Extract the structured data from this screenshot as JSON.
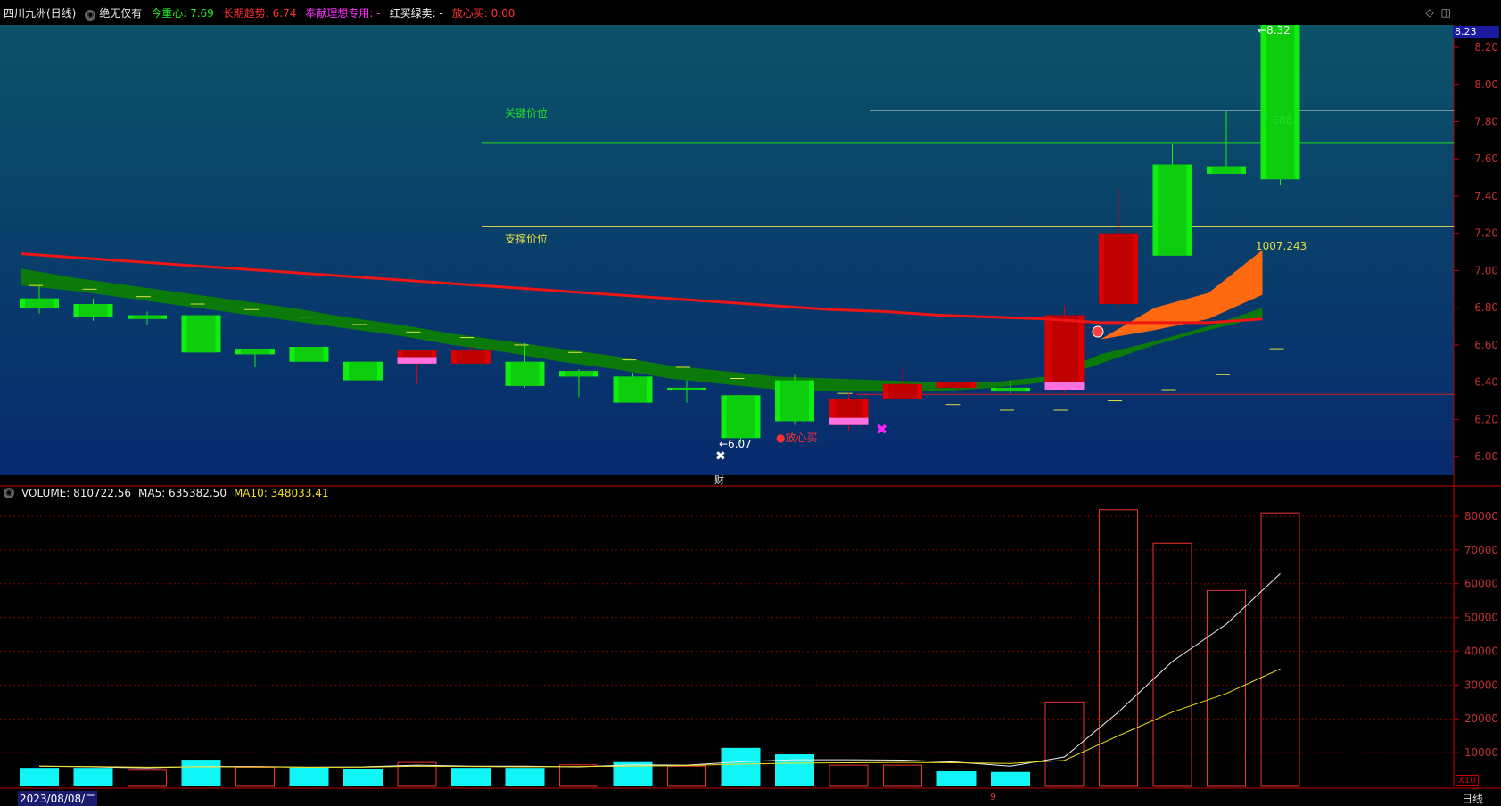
{
  "topbar": {
    "stock": "四川九洲(日线)",
    "indicator": "绝无仅有",
    "items": [
      {
        "label": "今重心: 7.69",
        "color": "#22ee22"
      },
      {
        "label": "长期趋势: 6.74",
        "color": "#ff3030"
      },
      {
        "label": "奉献理想专用: -",
        "color": "#ff30ff"
      },
      {
        "label": "红买绿卖: -",
        "color": "#ffffff"
      },
      {
        "label": "放心买: 0.00",
        "color": "#ff3030"
      }
    ],
    "right_icons": [
      "◇",
      "◫"
    ]
  },
  "volume_header": {
    "vol": "VOLUME: 810722.56",
    "ma5": "MA5: 635382.50",
    "ma10": "MA10: 348033.41"
  },
  "labels": {
    "key_price": "关键价位",
    "support_price": "支撑价位",
    "low_marker": "←6.07",
    "high_marker": "←8.32",
    "line_val": "7.688",
    "fan_val": "1007.243",
    "buy_signal": "●放心买",
    "cai": "财",
    "date": "2023/08/08/二",
    "month_tick": "9",
    "period": "日线",
    "current_price": "8.23",
    "vol_scale": "X10"
  },
  "chart_data": {
    "type": "candlestick",
    "price_ticks": [
      "8.20",
      "8.00",
      "7.80",
      "7.60",
      "7.40",
      "7.20",
      "7.00",
      "6.80",
      "6.60",
      "6.40",
      "6.20",
      "6.00"
    ],
    "volume_ticks": [
      "80000",
      "70000",
      "60000",
      "50000",
      "40000",
      "30000",
      "20000",
      "10000"
    ],
    "ylim_price": [
      5.9,
      8.32
    ],
    "ylim_volume": [
      0,
      85000
    ],
    "key_price_line": 7.688,
    "support_price_line": 7.235,
    "candles": [
      {
        "o": 6.85,
        "c": 6.8,
        "h": 6.92,
        "l": 6.77,
        "up": false
      },
      {
        "o": 6.82,
        "c": 6.75,
        "h": 6.85,
        "l": 6.73,
        "up": false
      },
      {
        "o": 6.76,
        "c": 6.74,
        "h": 6.78,
        "l": 6.71,
        "up": false
      },
      {
        "o": 6.76,
        "c": 6.56,
        "h": 6.76,
        "l": 6.56,
        "up": false
      },
      {
        "o": 6.58,
        "c": 6.55,
        "h": 6.58,
        "l": 6.48,
        "up": false
      },
      {
        "o": 6.59,
        "c": 6.51,
        "h": 6.61,
        "l": 6.46,
        "up": false
      },
      {
        "o": 6.51,
        "c": 6.41,
        "h": 6.51,
        "l": 6.41,
        "up": false
      },
      {
        "o": 6.5,
        "c": 6.57,
        "h": 6.57,
        "l": 6.39,
        "up": true,
        "pink": true
      },
      {
        "o": 6.5,
        "c": 6.57,
        "h": 6.59,
        "l": 6.5,
        "up": true
      },
      {
        "o": 6.51,
        "c": 6.38,
        "h": 6.61,
        "l": 6.37,
        "up": false
      },
      {
        "o": 6.46,
        "c": 6.43,
        "h": 6.47,
        "l": 6.32,
        "up": false
      },
      {
        "o": 6.43,
        "c": 6.29,
        "h": 6.45,
        "l": 6.29,
        "up": false
      },
      {
        "o": 6.37,
        "c": 6.36,
        "h": 6.41,
        "l": 6.29,
        "up": false
      },
      {
        "o": 6.33,
        "c": 6.1,
        "h": 6.33,
        "l": 6.07,
        "up": false
      },
      {
        "o": 6.41,
        "c": 6.19,
        "h": 6.44,
        "l": 6.17,
        "up": false
      },
      {
        "o": 6.17,
        "c": 6.31,
        "h": 6.34,
        "l": 6.14,
        "up": true,
        "pink": true
      },
      {
        "o": 6.31,
        "c": 6.39,
        "h": 6.48,
        "l": 6.31,
        "up": true
      },
      {
        "o": 6.37,
        "c": 6.4,
        "h": 6.4,
        "l": 6.36,
        "up": true
      },
      {
        "o": 6.37,
        "c": 6.35,
        "h": 6.41,
        "l": 6.34,
        "up": false
      },
      {
        "o": 6.36,
        "c": 6.76,
        "h": 6.81,
        "l": 6.34,
        "up": true,
        "pink": true
      },
      {
        "o": 6.82,
        "c": 7.2,
        "h": 7.44,
        "l": 6.8,
        "up": true
      },
      {
        "o": 7.57,
        "c": 7.08,
        "h": 7.68,
        "l": 7.08,
        "up": false
      },
      {
        "o": 7.56,
        "c": 7.52,
        "h": 7.86,
        "l": 7.52,
        "up": false
      },
      {
        "o": 8.32,
        "c": 7.49,
        "h": 8.32,
        "l": 7.46,
        "up": false
      }
    ],
    "dashes": [
      6.92,
      6.9,
      6.86,
      6.82,
      6.79,
      6.75,
      6.71,
      6.67,
      6.64,
      6.6,
      6.56,
      6.52,
      6.48,
      6.42,
      6.37,
      6.34,
      6.31,
      6.28,
      6.25,
      6.25,
      6.3,
      6.36,
      6.44,
      6.58
    ],
    "trend_line": [
      7.09,
      7.07,
      7.05,
      7.03,
      7.01,
      6.99,
      6.97,
      6.95,
      6.93,
      6.91,
      6.89,
      6.87,
      6.85,
      6.83,
      6.81,
      6.79,
      6.78,
      6.76,
      6.75,
      6.74,
      6.72,
      6.72,
      6.72,
      6.74
    ],
    "band_top": [
      7.01,
      6.96,
      6.92,
      6.88,
      6.84,
      6.8,
      6.75,
      6.71,
      6.66,
      6.62,
      6.58,
      6.54,
      6.49,
      6.46,
      6.43,
      6.42,
      6.41,
      6.4,
      6.4,
      6.43,
      6.55,
      6.62,
      6.7,
      6.8
    ],
    "band_bottom": [
      6.92,
      6.89,
      6.85,
      6.81,
      6.77,
      6.73,
      6.69,
      6.65,
      6.6,
      6.56,
      6.51,
      6.47,
      6.42,
      6.39,
      6.36,
      6.35,
      6.35,
      6.35,
      6.37,
      6.4,
      6.5,
      6.6,
      6.68,
      6.75
    ],
    "fan_upper": [
      6.63,
      6.8,
      6.88,
      7.11
    ],
    "fan_lower": [
      6.63,
      6.68,
      6.74,
      6.87
    ],
    "volumes": [
      {
        "v": 5500,
        "c": "cyan"
      },
      {
        "v": 5500,
        "c": "cyan"
      },
      {
        "v": 4800,
        "c": "red"
      },
      {
        "v": 7900,
        "c": "cyan"
      },
      {
        "v": 5700,
        "c": "red"
      },
      {
        "v": 5600,
        "c": "cyan"
      },
      {
        "v": 5100,
        "c": "cyan"
      },
      {
        "v": 7100,
        "c": "red"
      },
      {
        "v": 5500,
        "c": "cyan"
      },
      {
        "v": 5500,
        "c": "cyan"
      },
      {
        "v": 6400,
        "c": "red"
      },
      {
        "v": 7200,
        "c": "cyan"
      },
      {
        "v": 6000,
        "c": "red"
      },
      {
        "v": 11400,
        "c": "cyan"
      },
      {
        "v": 9500,
        "c": "cyan"
      },
      {
        "v": 6300,
        "c": "red"
      },
      {
        "v": 6300,
        "c": "red"
      },
      {
        "v": 4500,
        "c": "cyan"
      },
      {
        "v": 4300,
        "c": "cyan"
      },
      {
        "v": 25000,
        "c": "red"
      },
      {
        "v": 81900,
        "c": "red"
      },
      {
        "v": 72000,
        "c": "red"
      },
      {
        "v": 58000,
        "c": "red"
      },
      {
        "v": 81000,
        "c": "red"
      }
    ],
    "ma5": [
      6000,
      5800,
      5500,
      5900,
      5900,
      5700,
      5800,
      6300,
      6000,
      6000,
      5800,
      6400,
      6300,
      7300,
      7900,
      7900,
      7800,
      7200,
      6000,
      8700,
      22000,
      37000,
      48000,
      63000
    ],
    "ma10": [
      6000,
      5900,
      5700,
      5800,
      5800,
      5700,
      5700,
      6000,
      5900,
      5800,
      5900,
      6000,
      6200,
      6600,
      6900,
      7000,
      7100,
      7000,
      6800,
      7700,
      15000,
      22000,
      27500,
      34800
    ]
  }
}
